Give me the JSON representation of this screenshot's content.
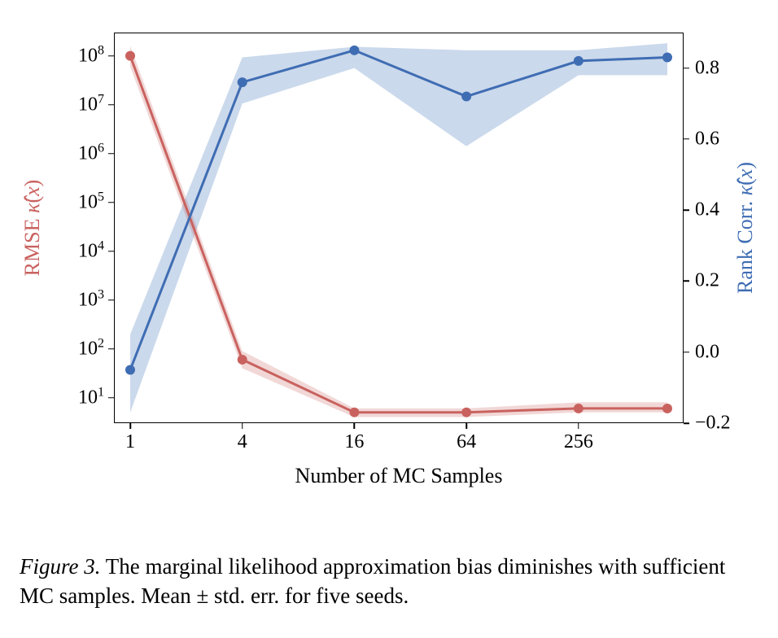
{
  "chart_data": {
    "type": "line",
    "x": [
      1,
      4,
      16,
      64,
      256,
      768
    ],
    "x_scale": "log",
    "series": [
      {
        "name": "RMSE κ̂(x)",
        "axis": "left",
        "color": "#c9625f",
        "values": [
          100000000.0,
          60.0,
          5.0,
          5.0,
          6.0,
          6.0
        ],
        "err_low": [
          60000000.0,
          40.0,
          4.0,
          4.0,
          5.0,
          5.0
        ],
        "err_high": [
          160000000.0,
          90.0,
          6.0,
          6.0,
          8.0,
          8.0
        ]
      },
      {
        "name": "Rank Corr. κ̂(x)",
        "axis": "right",
        "color": "#3f6db3",
        "values": [
          -0.05,
          0.76,
          0.85,
          0.72,
          0.82,
          0.83
        ],
        "err_low": [
          -0.17,
          0.7,
          0.8,
          0.58,
          0.78,
          0.78
        ],
        "err_high": [
          0.05,
          0.83,
          0.86,
          0.85,
          0.85,
          0.87
        ]
      }
    ],
    "title": "",
    "xlabel": "Number of MC Samples",
    "ylabel_left": "RMSE κ̂(x)",
    "ylabel_right": "Rank Corr. κ̂(x)",
    "y_left": {
      "scale": "log",
      "ticks": [
        10.0,
        100.0,
        1000.0,
        10000.0,
        100000.0,
        1000000.0,
        10000000.0,
        100000000.0
      ],
      "range": [
        3,
        300000000.0
      ]
    },
    "y_right": {
      "scale": "linear",
      "ticks": [
        -0.2,
        0.0,
        0.2,
        0.4,
        0.6,
        0.8
      ],
      "range": [
        -0.2,
        0.9
      ]
    },
    "x_ticks": [
      1,
      4,
      16,
      64,
      256
    ]
  },
  "caption": {
    "label": "Figure 3.",
    "text": "The marginal likelihood approximation bias diminishes with sufficient MC samples. Mean ± std. err. for five seeds."
  },
  "axis_labels": {
    "left_prefix": "RMSE ",
    "right_prefix": "Rank Corr. ",
    "kappa_html": "κ̂(x)",
    "bottom": "Number of MC Samples"
  },
  "tick_labels": {
    "x": [
      "1",
      "4",
      "16",
      "64",
      "256"
    ],
    "yl": [
      "10^1",
      "10^2",
      "10^3",
      "10^4",
      "10^5",
      "10^6",
      "10^7",
      "10^8"
    ],
    "yr": [
      "−0.2",
      "0.0",
      "0.2",
      "0.4",
      "0.6",
      "0.8"
    ]
  }
}
